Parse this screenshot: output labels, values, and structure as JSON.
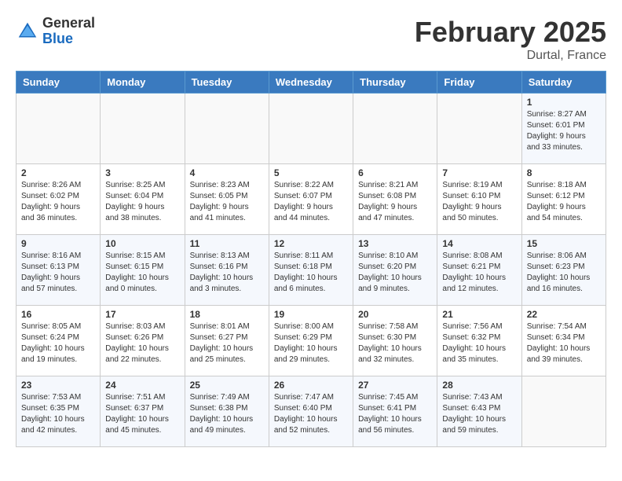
{
  "header": {
    "logo_general": "General",
    "logo_blue": "Blue",
    "month_title": "February 2025",
    "location": "Durtal, France"
  },
  "weekdays": [
    "Sunday",
    "Monday",
    "Tuesday",
    "Wednesday",
    "Thursday",
    "Friday",
    "Saturday"
  ],
  "weeks": [
    [
      {
        "day": "",
        "info": ""
      },
      {
        "day": "",
        "info": ""
      },
      {
        "day": "",
        "info": ""
      },
      {
        "day": "",
        "info": ""
      },
      {
        "day": "",
        "info": ""
      },
      {
        "day": "",
        "info": ""
      },
      {
        "day": "1",
        "info": "Sunrise: 8:27 AM\nSunset: 6:01 PM\nDaylight: 9 hours and 33 minutes."
      }
    ],
    [
      {
        "day": "2",
        "info": "Sunrise: 8:26 AM\nSunset: 6:02 PM\nDaylight: 9 hours and 36 minutes."
      },
      {
        "day": "3",
        "info": "Sunrise: 8:25 AM\nSunset: 6:04 PM\nDaylight: 9 hours and 38 minutes."
      },
      {
        "day": "4",
        "info": "Sunrise: 8:23 AM\nSunset: 6:05 PM\nDaylight: 9 hours and 41 minutes."
      },
      {
        "day": "5",
        "info": "Sunrise: 8:22 AM\nSunset: 6:07 PM\nDaylight: 9 hours and 44 minutes."
      },
      {
        "day": "6",
        "info": "Sunrise: 8:21 AM\nSunset: 6:08 PM\nDaylight: 9 hours and 47 minutes."
      },
      {
        "day": "7",
        "info": "Sunrise: 8:19 AM\nSunset: 6:10 PM\nDaylight: 9 hours and 50 minutes."
      },
      {
        "day": "8",
        "info": "Sunrise: 8:18 AM\nSunset: 6:12 PM\nDaylight: 9 hours and 54 minutes."
      }
    ],
    [
      {
        "day": "9",
        "info": "Sunrise: 8:16 AM\nSunset: 6:13 PM\nDaylight: 9 hours and 57 minutes."
      },
      {
        "day": "10",
        "info": "Sunrise: 8:15 AM\nSunset: 6:15 PM\nDaylight: 10 hours and 0 minutes."
      },
      {
        "day": "11",
        "info": "Sunrise: 8:13 AM\nSunset: 6:16 PM\nDaylight: 10 hours and 3 minutes."
      },
      {
        "day": "12",
        "info": "Sunrise: 8:11 AM\nSunset: 6:18 PM\nDaylight: 10 hours and 6 minutes."
      },
      {
        "day": "13",
        "info": "Sunrise: 8:10 AM\nSunset: 6:20 PM\nDaylight: 10 hours and 9 minutes."
      },
      {
        "day": "14",
        "info": "Sunrise: 8:08 AM\nSunset: 6:21 PM\nDaylight: 10 hours and 12 minutes."
      },
      {
        "day": "15",
        "info": "Sunrise: 8:06 AM\nSunset: 6:23 PM\nDaylight: 10 hours and 16 minutes."
      }
    ],
    [
      {
        "day": "16",
        "info": "Sunrise: 8:05 AM\nSunset: 6:24 PM\nDaylight: 10 hours and 19 minutes."
      },
      {
        "day": "17",
        "info": "Sunrise: 8:03 AM\nSunset: 6:26 PM\nDaylight: 10 hours and 22 minutes."
      },
      {
        "day": "18",
        "info": "Sunrise: 8:01 AM\nSunset: 6:27 PM\nDaylight: 10 hours and 25 minutes."
      },
      {
        "day": "19",
        "info": "Sunrise: 8:00 AM\nSunset: 6:29 PM\nDaylight: 10 hours and 29 minutes."
      },
      {
        "day": "20",
        "info": "Sunrise: 7:58 AM\nSunset: 6:30 PM\nDaylight: 10 hours and 32 minutes."
      },
      {
        "day": "21",
        "info": "Sunrise: 7:56 AM\nSunset: 6:32 PM\nDaylight: 10 hours and 35 minutes."
      },
      {
        "day": "22",
        "info": "Sunrise: 7:54 AM\nSunset: 6:34 PM\nDaylight: 10 hours and 39 minutes."
      }
    ],
    [
      {
        "day": "23",
        "info": "Sunrise: 7:53 AM\nSunset: 6:35 PM\nDaylight: 10 hours and 42 minutes."
      },
      {
        "day": "24",
        "info": "Sunrise: 7:51 AM\nSunset: 6:37 PM\nDaylight: 10 hours and 45 minutes."
      },
      {
        "day": "25",
        "info": "Sunrise: 7:49 AM\nSunset: 6:38 PM\nDaylight: 10 hours and 49 minutes."
      },
      {
        "day": "26",
        "info": "Sunrise: 7:47 AM\nSunset: 6:40 PM\nDaylight: 10 hours and 52 minutes."
      },
      {
        "day": "27",
        "info": "Sunrise: 7:45 AM\nSunset: 6:41 PM\nDaylight: 10 hours and 56 minutes."
      },
      {
        "day": "28",
        "info": "Sunrise: 7:43 AM\nSunset: 6:43 PM\nDaylight: 10 hours and 59 minutes."
      },
      {
        "day": "",
        "info": ""
      }
    ]
  ]
}
